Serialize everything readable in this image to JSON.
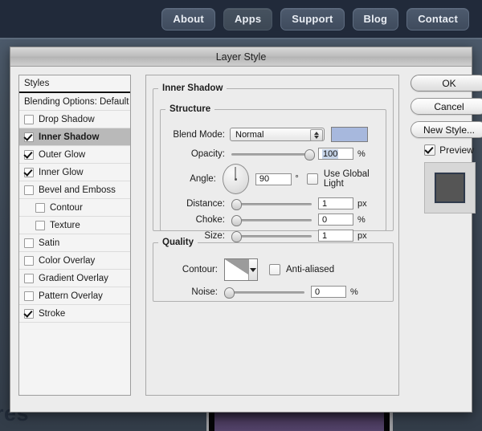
{
  "topnav": {
    "items": [
      {
        "label": "About",
        "active": true
      },
      {
        "label": "Apps",
        "active": false
      },
      {
        "label": "Support",
        "active": true
      },
      {
        "label": "Blog",
        "active": true
      },
      {
        "label": "Contact",
        "active": true
      }
    ]
  },
  "background": {
    "partial_text": "res",
    "colors": {
      "top_band": "#212a3a",
      "page_gradient_top": "#4c5a6b",
      "page_gradient_bottom": "#333d49",
      "thumbnail_purple": "#4a3a5d"
    }
  },
  "dialog": {
    "title": "Layer Style",
    "styles_list": {
      "header": "Styles",
      "blending_options": "Blending Options: Default",
      "items": [
        {
          "label": "Drop Shadow",
          "checked": false,
          "selected": false,
          "indent": false
        },
        {
          "label": "Inner Shadow",
          "checked": true,
          "selected": true,
          "indent": false
        },
        {
          "label": "Outer Glow",
          "checked": true,
          "selected": false,
          "indent": false
        },
        {
          "label": "Inner Glow",
          "checked": true,
          "selected": false,
          "indent": false
        },
        {
          "label": "Bevel and Emboss",
          "checked": false,
          "selected": false,
          "indent": false
        },
        {
          "label": "Contour",
          "checked": false,
          "selected": false,
          "indent": true
        },
        {
          "label": "Texture",
          "checked": false,
          "selected": false,
          "indent": true
        },
        {
          "label": "Satin",
          "checked": false,
          "selected": false,
          "indent": false
        },
        {
          "label": "Color Overlay",
          "checked": false,
          "selected": false,
          "indent": false
        },
        {
          "label": "Gradient Overlay",
          "checked": false,
          "selected": false,
          "indent": false
        },
        {
          "label": "Pattern Overlay",
          "checked": false,
          "selected": false,
          "indent": false
        },
        {
          "label": "Stroke",
          "checked": true,
          "selected": false,
          "indent": false
        }
      ]
    },
    "inner_shadow": {
      "group_label": "Inner Shadow",
      "structure": {
        "group_label": "Structure",
        "blend_mode": {
          "label": "Blend Mode:",
          "value": "Normal"
        },
        "color_swatch": "#a7b8dd",
        "opacity": {
          "label": "Opacity:",
          "value": "100",
          "unit": "%",
          "slider_pct": 100
        },
        "angle": {
          "label": "Angle:",
          "value": "90",
          "unit": "°",
          "dial_degrees": 90,
          "use_global_light": {
            "label": "Use Global Light",
            "checked": false
          }
        },
        "distance": {
          "label": "Distance:",
          "value": "1",
          "unit": "px",
          "slider_pct": 2
        },
        "choke": {
          "label": "Choke:",
          "value": "0",
          "unit": "%",
          "slider_pct": 0
        },
        "size": {
          "label": "Size:",
          "value": "1",
          "unit": "px",
          "slider_pct": 1
        }
      },
      "quality": {
        "group_label": "Quality",
        "contour": {
          "label": "Contour:"
        },
        "anti_aliased": {
          "label": "Anti-aliased",
          "checked": false
        },
        "noise": {
          "label": "Noise:",
          "value": "0",
          "unit": "%",
          "slider_pct": 0
        }
      }
    },
    "buttons": {
      "ok": "OK",
      "cancel": "Cancel",
      "new_style": "New Style...",
      "preview": {
        "label": "Preview",
        "checked": true
      }
    }
  }
}
